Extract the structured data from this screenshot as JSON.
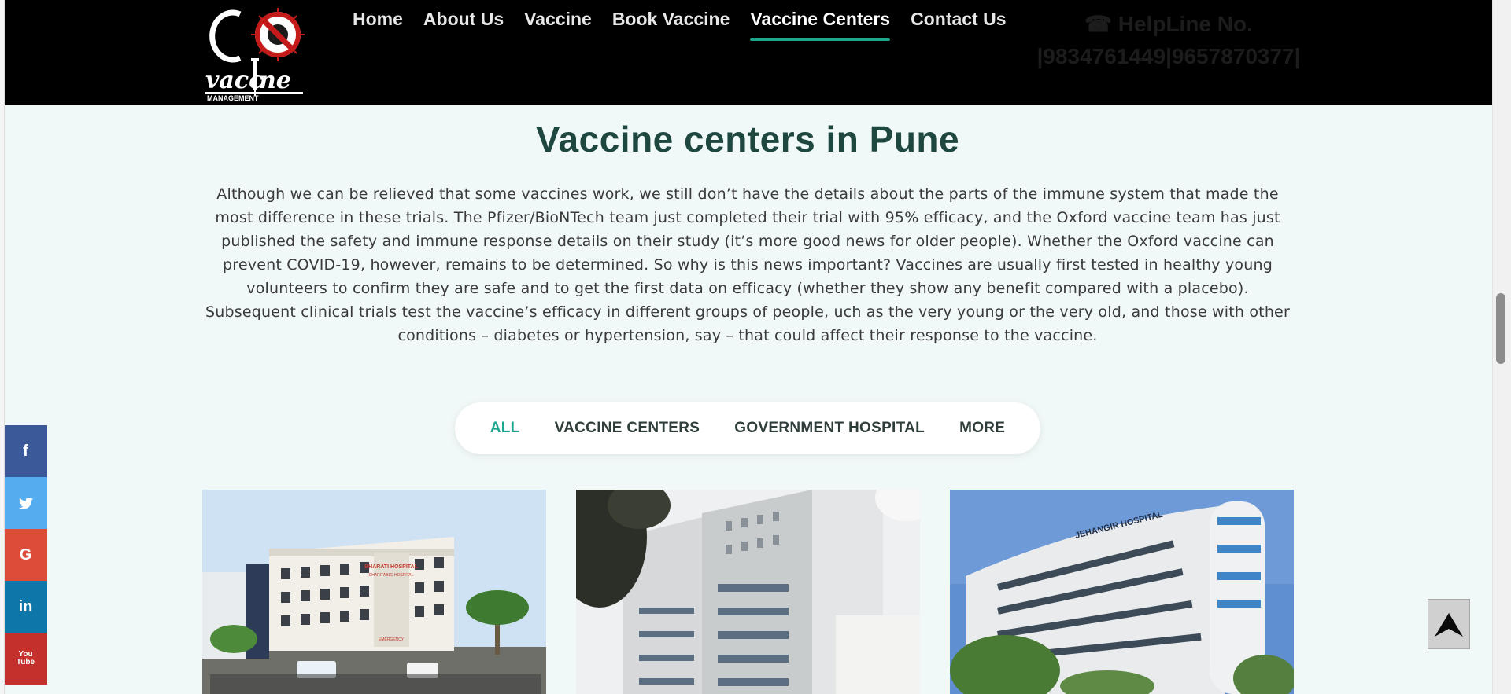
{
  "nav": {
    "items": [
      {
        "label": "Home"
      },
      {
        "label": "About Us"
      },
      {
        "label": "Vaccine"
      },
      {
        "label": "Book Vaccine"
      },
      {
        "label": "Vaccine Centers"
      },
      {
        "label": "Contact Us"
      }
    ],
    "active": "Vaccine Centers"
  },
  "logo": {
    "text": "CO vaccine",
    "sub": "MANAGEMENT"
  },
  "helpline": {
    "icon": "phone-icon",
    "label": "HelpLine No.",
    "numbers": "|9834761449|9657870377|"
  },
  "main": {
    "title": "Vaccine centers in Pune",
    "intro": "Although we can be relieved that some vaccines work, we still don’t have the details about the parts of the immune system that made the most difference in these trials. The Pfizer/BioNTech team just completed their trial with 95% efficacy, and the Oxford vaccine team has just published the safety and immune response details on their study (it’s more good news for older people). Whether the Oxford vaccine can prevent COVID-19, however, remains to be determined. So why is this news important? Vaccines are usually first tested in healthy young volunteers to confirm they are safe and to get the first data on efficacy (whether they show any benefit compared with a placebo). Subsequent clinical trials test the vaccine’s efficacy in different groups of people, uch as the very young or the very old, and those with other conditions – diabetes or hypertension, say – that could affect their response to the vaccine."
  },
  "filters": {
    "items": [
      {
        "label": "ALL"
      },
      {
        "label": "VACCINE CENTERS"
      },
      {
        "label": "GOVERNMENT HOSPITAL"
      },
      {
        "label": "MORE"
      }
    ],
    "active": "ALL"
  },
  "cards": [
    {
      "sign": "BHARATI HOSPITAL",
      "sign2": "CHARITABLE HOSPITAL",
      "sub": "EMERGENCY"
    },
    {
      "sign": ""
    },
    {
      "sign": "JEHANGIR HOSPITAL"
    }
  ],
  "social": [
    {
      "icon": "facebook-icon",
      "glyph": "f",
      "color": "#3b5998"
    },
    {
      "icon": "twitter-icon",
      "glyph": "🐦",
      "color": "#55acee"
    },
    {
      "icon": "google-icon",
      "glyph": "G",
      "color": "#dd4b39"
    },
    {
      "icon": "linkedin-icon",
      "glyph": "in",
      "color": "#0e76a8"
    },
    {
      "icon": "youtube-icon",
      "glyph": "You Tube",
      "color": "#c4302b"
    }
  ],
  "colors": {
    "accent": "#1aa78c",
    "header_bg": "#000000",
    "title": "#1e4740",
    "page_bg": "#f1f8f8"
  }
}
